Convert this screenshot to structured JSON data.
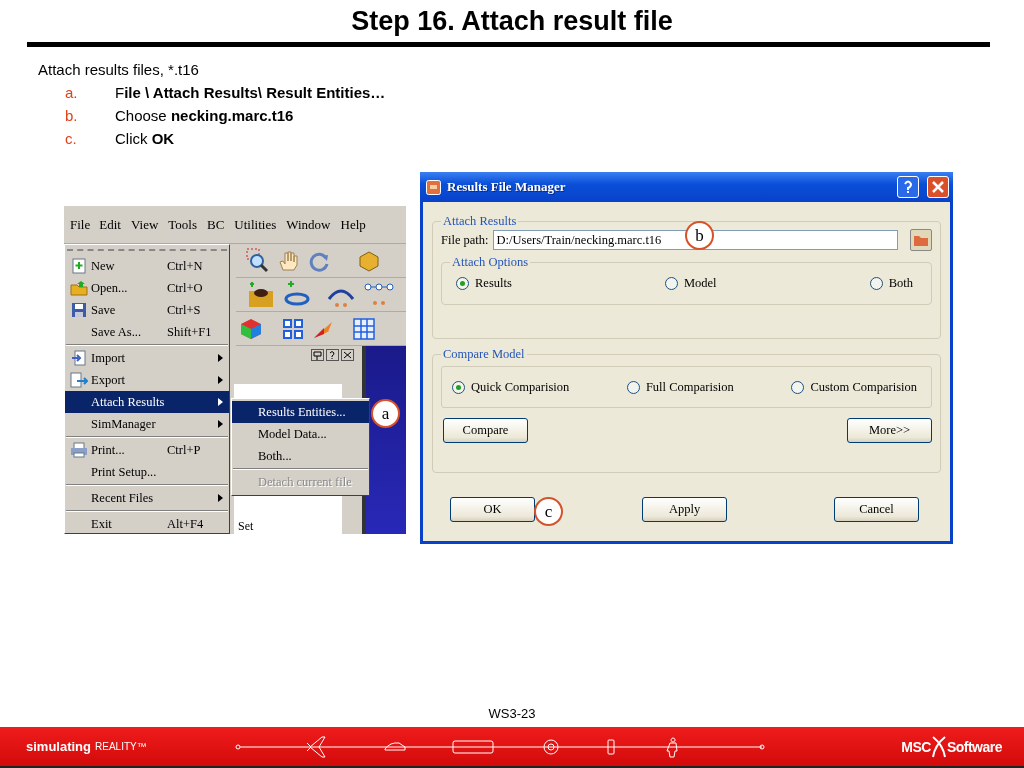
{
  "title": "Step 16. Attach result file",
  "intro": "Attach results files, *.t16",
  "steps": [
    {
      "marker": "a.",
      "text": "F**ile \\ Attach Results\\ Result Entities…**"
    },
    {
      "marker": "b.",
      "text": "Choose **necking.marc.t16**"
    },
    {
      "marker": "c.",
      "text": "Click **OK**"
    }
  ],
  "menu_screenshot": {
    "menubar": [
      "File",
      "Edit",
      "View",
      "Tools",
      "BC",
      "Utilities",
      "Window",
      "Help"
    ],
    "file_menu": {
      "groups": [
        {
          "items": [
            {
              "label": "New",
              "shortcut": "Ctrl+N",
              "submenu": false,
              "selected": false
            },
            {
              "label": "Open...",
              "shortcut": "Ctrl+O",
              "submenu": false,
              "selected": false
            },
            {
              "label": "Save",
              "shortcut": "Ctrl+S",
              "submenu": false,
              "selected": false
            },
            {
              "label": "Save As...",
              "shortcut": "Shift+F1",
              "submenu": false,
              "selected": false
            }
          ]
        },
        {
          "items": [
            {
              "label": "Import",
              "submenu": true,
              "selected": false
            },
            {
              "label": "Export",
              "submenu": true,
              "selected": false
            },
            {
              "label": "Attach Results",
              "submenu": true,
              "selected": true
            },
            {
              "label": "SimManager",
              "submenu": true,
              "selected": false
            }
          ]
        },
        {
          "items": [
            {
              "label": "Print...",
              "shortcut": "Ctrl+P",
              "submenu": false,
              "selected": false
            },
            {
              "label": "Print Setup...",
              "submenu": false,
              "selected": false
            }
          ]
        },
        {
          "items": [
            {
              "label": "Recent Files",
              "submenu": true,
              "selected": false
            }
          ]
        },
        {
          "items": [
            {
              "label": "Exit",
              "shortcut": "Alt+F4",
              "submenu": false,
              "selected": false
            }
          ]
        }
      ]
    },
    "submenu": [
      {
        "label": "Results Entities...",
        "selected": true,
        "disabled": false,
        "separator_before": false
      },
      {
        "label": "Model Data...",
        "selected": false,
        "disabled": false,
        "separator_before": false
      },
      {
        "label": "Both...",
        "selected": false,
        "disabled": false,
        "separator_before": false
      },
      {
        "label": "Detach current file",
        "selected": false,
        "disabled": true,
        "separator_before": true
      }
    ],
    "panel_text": "Set"
  },
  "dialog": {
    "title": "Results File Manager",
    "attach_results": {
      "legend": "Attach Results",
      "file_path_label": "File path:",
      "file_path": "D:/Users/Train/necking.marc.t16",
      "options_legend": "Attach Options",
      "options": [
        {
          "label": "Results",
          "selected": true
        },
        {
          "label": "Model",
          "selected": false
        },
        {
          "label": "Both",
          "selected": false
        }
      ]
    },
    "compare_model": {
      "legend": "Compare Model",
      "options": [
        {
          "label": "Quick Comparision",
          "selected": true
        },
        {
          "label": "Full Comparision",
          "selected": false
        },
        {
          "label": "Custom Comparision",
          "selected": false
        }
      ],
      "buttons": [
        "Compare",
        "More>>"
      ]
    },
    "buttons": [
      "OK",
      "Apply",
      "Cancel"
    ]
  },
  "callouts": [
    "a",
    "b",
    "c"
  ],
  "footer": {
    "page": "WS3-23",
    "tagline": "simulating",
    "tagline_small": "REALITY™",
    "logo_left": "MSC",
    "logo_right": "Software"
  }
}
